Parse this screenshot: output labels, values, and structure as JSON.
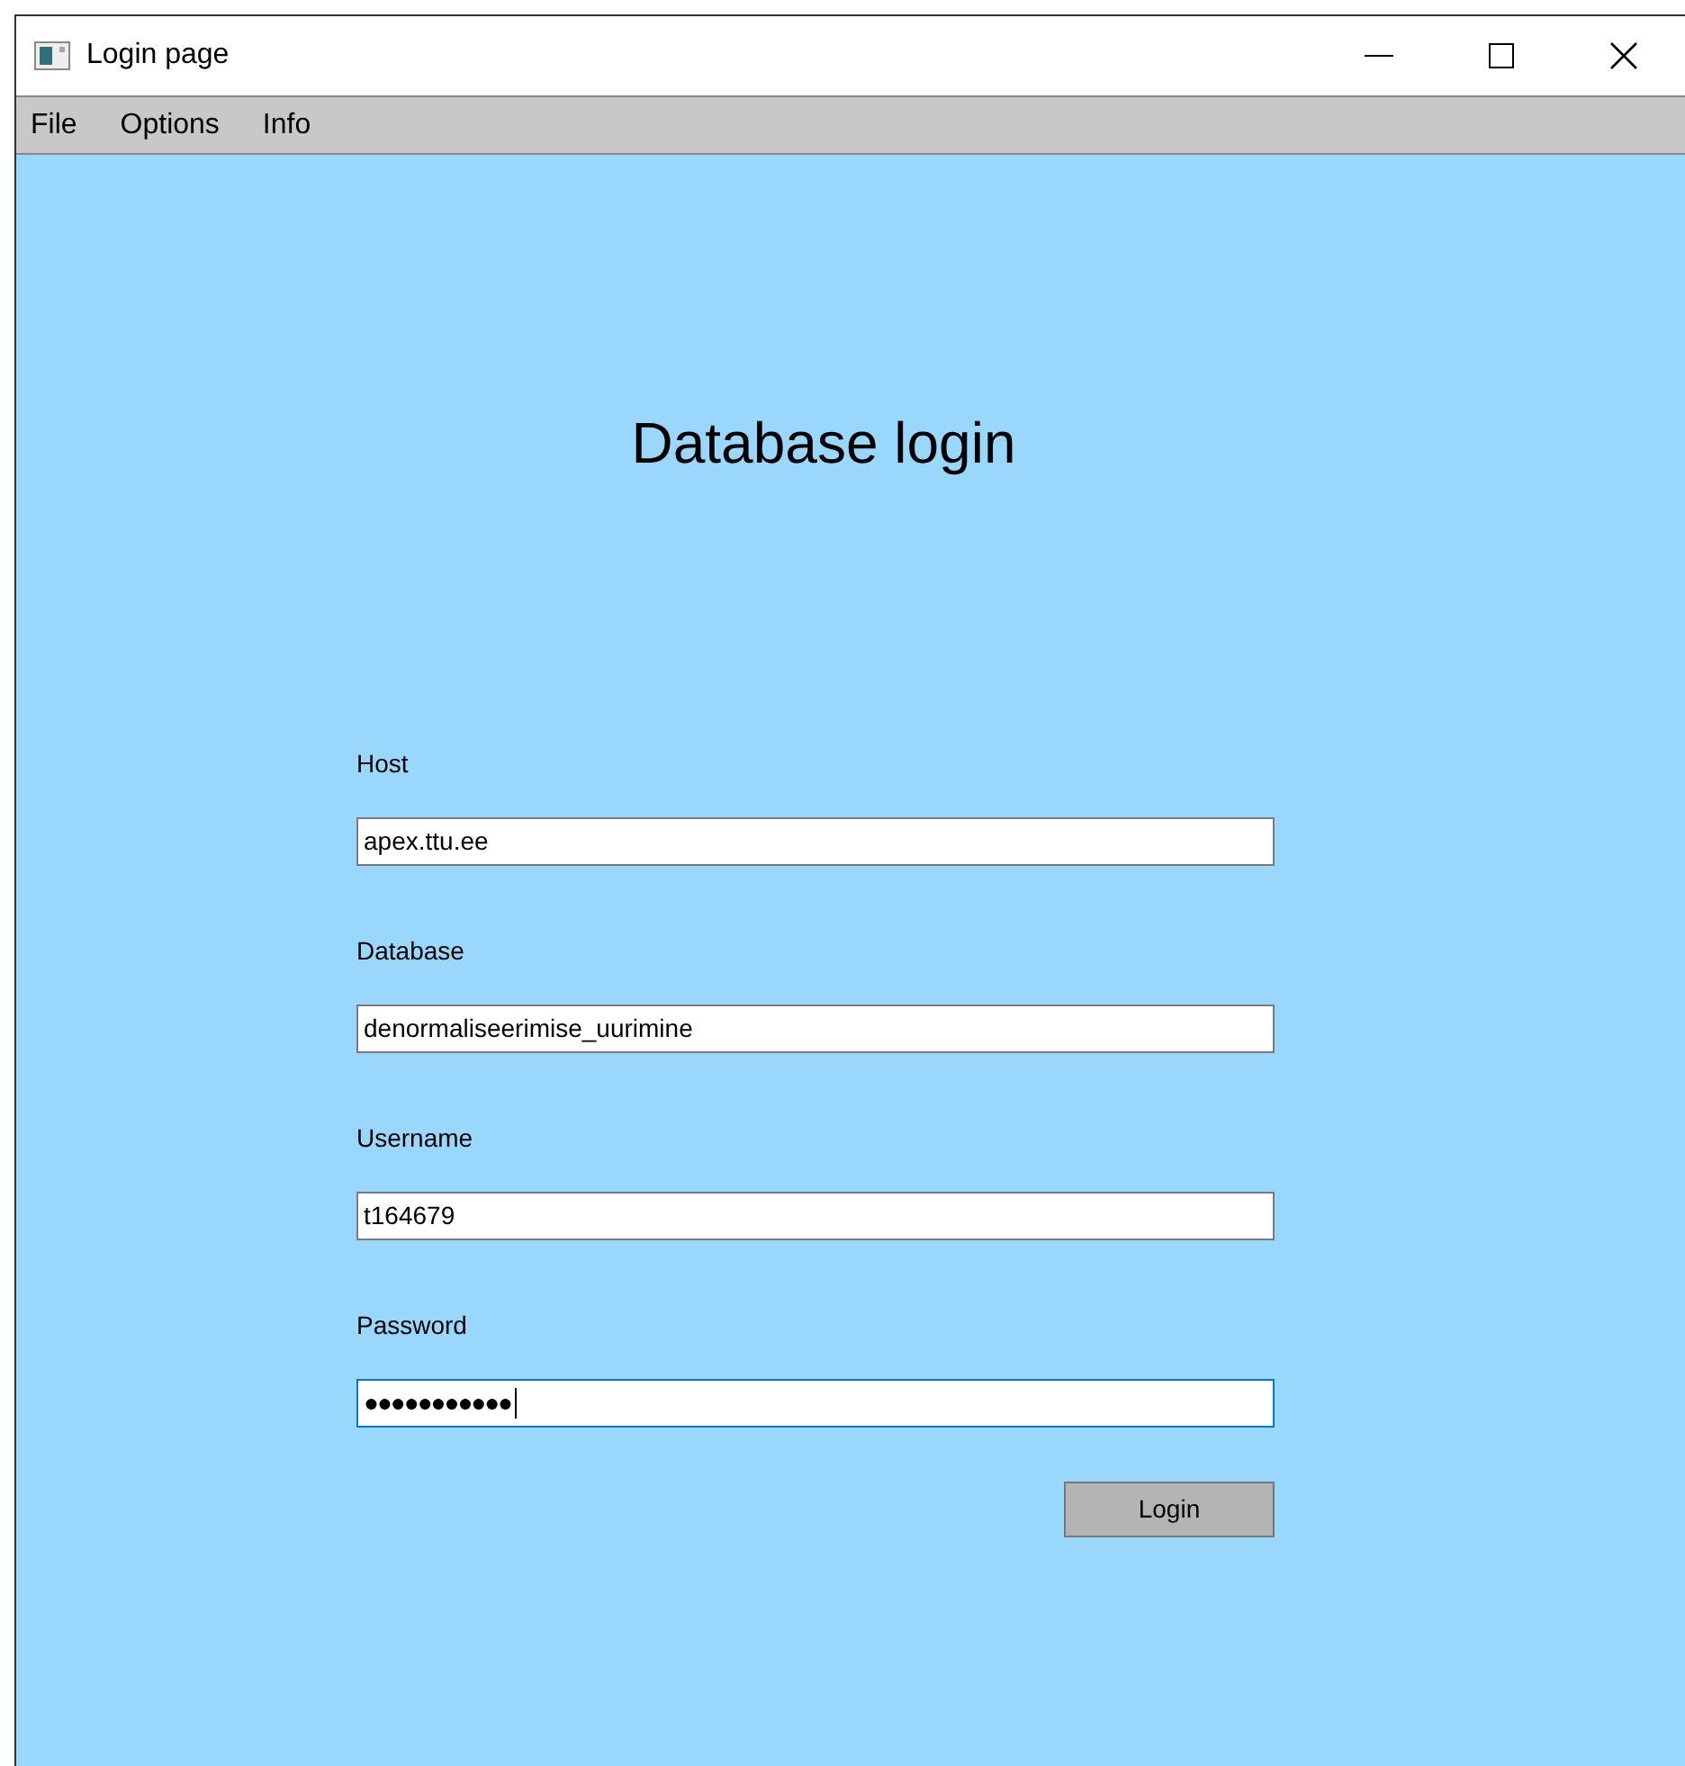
{
  "window": {
    "title": "Login page"
  },
  "menu": [
    "File",
    "Options",
    "Info"
  ],
  "heading": "Database login",
  "fields": [
    {
      "label": "Host",
      "value": "apex.ttu.ee",
      "focused": false
    },
    {
      "label": "Database",
      "value": "denormaliseerimise_uurimine",
      "focused": false
    },
    {
      "label": "Username",
      "value": "t164679",
      "focused": false
    },
    {
      "label": "Password",
      "value": "●●●●●●●●●●●",
      "focused": true
    }
  ],
  "button": "Login"
}
